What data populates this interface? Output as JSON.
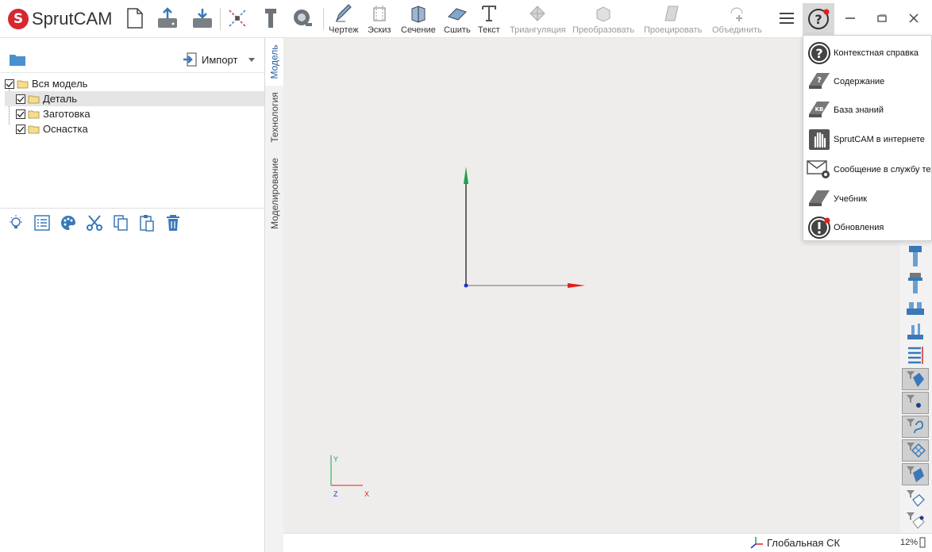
{
  "app": {
    "logo_text": "SprutCAM"
  },
  "toolbar": {
    "buttons": [
      {
        "label": "Чертеж",
        "enabled": true
      },
      {
        "label": "Эскиз",
        "enabled": true
      },
      {
        "label": "Сечение",
        "enabled": true
      },
      {
        "label": "Сшить",
        "enabled": true
      },
      {
        "label": "Текст",
        "enabled": true
      },
      {
        "label": "Триангуляция",
        "enabled": false
      },
      {
        "label": "Преобразовать",
        "enabled": false
      },
      {
        "label": "Проецировать",
        "enabled": false
      },
      {
        "label": "Объединить",
        "enabled": false
      }
    ]
  },
  "left_panel": {
    "import_label": "Импорт",
    "tree": [
      {
        "label": "Вся модель",
        "checked": true,
        "level": 0,
        "selected": false
      },
      {
        "label": "Деталь",
        "checked": true,
        "level": 1,
        "selected": true
      },
      {
        "label": "Заготовка",
        "checked": true,
        "level": 1,
        "selected": false
      },
      {
        "label": "Оснастка",
        "checked": true,
        "level": 1,
        "selected": false
      }
    ]
  },
  "side_tabs": [
    "Модель",
    "Технология",
    "Моделирование"
  ],
  "viewport": {
    "triad": {
      "y_label": "Y",
      "z_label": "Z",
      "x_label": "X"
    }
  },
  "help_menu": {
    "items": [
      {
        "label": "Контекстная справка",
        "icon": "question-icon"
      },
      {
        "label": "Содержание",
        "icon": "book-question-icon"
      },
      {
        "label": "База знаний",
        "icon": "book-kb-icon"
      },
      {
        "label": "SprutCAM в интернете",
        "icon": "hand-icon"
      },
      {
        "label": "Сообщение в службу тех",
        "icon": "mail-gear-icon"
      },
      {
        "label": "Учебник",
        "icon": "book-icon"
      },
      {
        "label": "Обновления",
        "icon": "exclamation-icon"
      }
    ]
  },
  "status": {
    "coordinate_system": "Глобальная СК",
    "zoom": "12%"
  },
  "colors": {
    "brand": "#d7282f",
    "axis_x": "#e02020",
    "axis_y": "#1aa34a",
    "accent_icon": "#3a78b8"
  }
}
